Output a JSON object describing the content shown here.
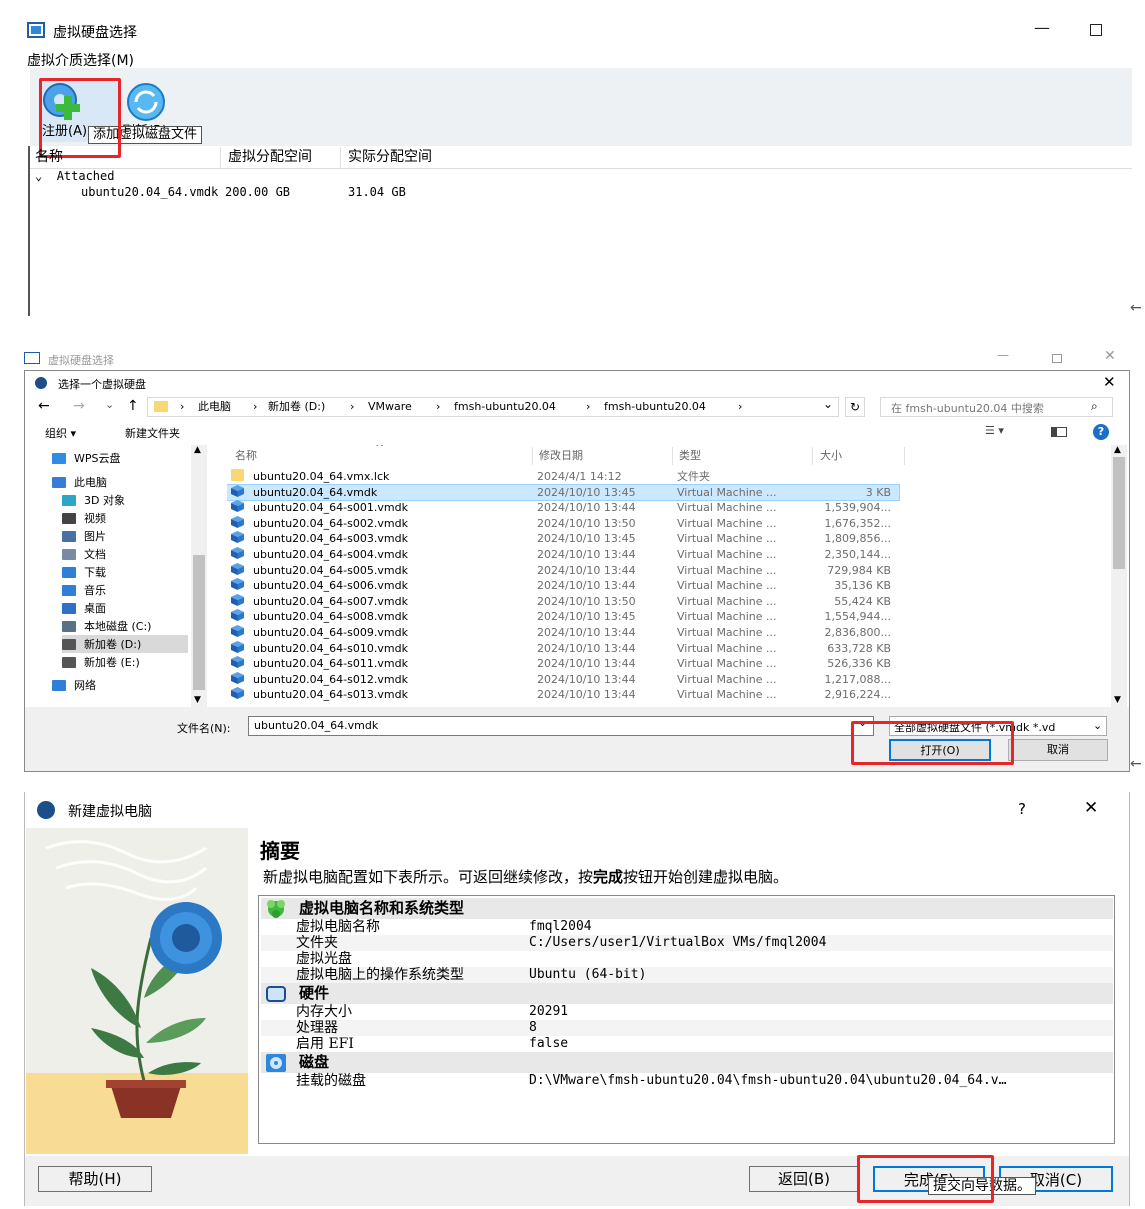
{
  "panel1": {
    "window_title": "虚拟硬盘选择",
    "menu_label": "虚拟介质选择(M)",
    "toolbar": {
      "register_label": "注册(A)",
      "refresh_label": "刷新(R)"
    },
    "tooltip": "添加虚拟磁盘文件",
    "columns": [
      "名称",
      "虚拟分配空间",
      "实际分配空间"
    ],
    "group_label": "Attached",
    "rows": [
      {
        "name": "ubuntu20.04_64.vmdk",
        "virtual": "200.00 GB",
        "actual": "31.04 GB"
      }
    ]
  },
  "panel2": {
    "bg_title": "虚拟硬盘选择",
    "dialog_title": "选择一个虚拟硬盘",
    "breadcrumb": [
      "此电脑",
      "新加卷 (D:)",
      "VMware",
      "fmsh-ubuntu20.04",
      "fmsh-ubuntu20.04"
    ],
    "search_placeholder": "在 fmsh-ubuntu20.04 中搜索",
    "toolbar": {
      "organize_label": "组织 ▾",
      "new_folder_label": "新建文件夹"
    },
    "nav": [
      {
        "label": "WPS云盘",
        "color": "#2f8de4"
      },
      {
        "label": "此电脑",
        "color": "#3a7bd5"
      },
      {
        "label": "3D 对象",
        "color": "#2aa6c9"
      },
      {
        "label": "视频",
        "color": "#444444"
      },
      {
        "label": "图片",
        "color": "#4a6fa5"
      },
      {
        "label": "文档",
        "color": "#7a8aa0"
      },
      {
        "label": "下载",
        "color": "#2f7fd8"
      },
      {
        "label": "音乐",
        "color": "#2f7fd8"
      },
      {
        "label": "桌面",
        "color": "#2f6fc8"
      },
      {
        "label": "本地磁盘 (C:)",
        "color": "#5b6f87"
      },
      {
        "label": "新加卷 (D:)",
        "color": "#555555"
      },
      {
        "label": "新加卷 (E:)",
        "color": "#555555"
      },
      {
        "label": "网络",
        "color": "#2f7fd8"
      }
    ],
    "columns": [
      "名称",
      "修改日期",
      "类型",
      "大小"
    ],
    "files": [
      {
        "name": "ubuntu20.04_64.vmx.lck",
        "date": "2024/4/1 14:12",
        "type": "文件夹",
        "size": "",
        "icon": "folder-icon"
      },
      {
        "name": "ubuntu20.04_64.vmdk",
        "date": "2024/10/10 13:45",
        "type": "Virtual Machine ...",
        "size": "3 KB",
        "icon": "vbox-disk-icon"
      },
      {
        "name": "ubuntu20.04_64-s001.vmdk",
        "date": "2024/10/10 13:44",
        "type": "Virtual Machine ...",
        "size": "1,539,904...",
        "icon": "vbox-disk-icon"
      },
      {
        "name": "ubuntu20.04_64-s002.vmdk",
        "date": "2024/10/10 13:50",
        "type": "Virtual Machine ...",
        "size": "1,676,352...",
        "icon": "vbox-disk-icon"
      },
      {
        "name": "ubuntu20.04_64-s003.vmdk",
        "date": "2024/10/10 13:45",
        "type": "Virtual Machine ...",
        "size": "1,809,856...",
        "icon": "vbox-disk-icon"
      },
      {
        "name": "ubuntu20.04_64-s004.vmdk",
        "date": "2024/10/10 13:44",
        "type": "Virtual Machine ...",
        "size": "2,350,144...",
        "icon": "vbox-disk-icon"
      },
      {
        "name": "ubuntu20.04_64-s005.vmdk",
        "date": "2024/10/10 13:44",
        "type": "Virtual Machine ...",
        "size": "729,984 KB",
        "icon": "vbox-disk-icon"
      },
      {
        "name": "ubuntu20.04_64-s006.vmdk",
        "date": "2024/10/10 13:44",
        "type": "Virtual Machine ...",
        "size": "35,136 KB",
        "icon": "vbox-disk-icon"
      },
      {
        "name": "ubuntu20.04_64-s007.vmdk",
        "date": "2024/10/10 13:50",
        "type": "Virtual Machine ...",
        "size": "55,424 KB",
        "icon": "vbox-disk-icon"
      },
      {
        "name": "ubuntu20.04_64-s008.vmdk",
        "date": "2024/10/10 13:45",
        "type": "Virtual Machine ...",
        "size": "1,554,944...",
        "icon": "vbox-disk-icon"
      },
      {
        "name": "ubuntu20.04_64-s009.vmdk",
        "date": "2024/10/10 13:44",
        "type": "Virtual Machine ...",
        "size": "2,836,800...",
        "icon": "vbox-disk-icon"
      },
      {
        "name": "ubuntu20.04_64-s010.vmdk",
        "date": "2024/10/10 13:44",
        "type": "Virtual Machine ...",
        "size": "633,728 KB",
        "icon": "vbox-disk-icon"
      },
      {
        "name": "ubuntu20.04_64-s011.vmdk",
        "date": "2024/10/10 13:44",
        "type": "Virtual Machine ...",
        "size": "526,336 KB",
        "icon": "vbox-disk-icon"
      },
      {
        "name": "ubuntu20.04_64-s012.vmdk",
        "date": "2024/10/10 13:44",
        "type": "Virtual Machine ...",
        "size": "1,217,088...",
        "icon": "vbox-disk-icon"
      },
      {
        "name": "ubuntu20.04_64-s013.vmdk",
        "date": "2024/10/10 13:44",
        "type": "Virtual Machine ...",
        "size": "2,916,224...",
        "icon": "vbox-disk-icon"
      }
    ],
    "filename_label": "文件名(N):",
    "filename_value": "ubuntu20.04_64.vmdk",
    "filter_value": "全部虚拟硬盘文件 (*.vmdk *.vd",
    "open_label": "打开(O)",
    "cancel_label": "取消"
  },
  "panel3": {
    "window_title": "新建虚拟电脑",
    "help_glyph": "?",
    "heading": "摘要",
    "description_pre": "新虚拟电脑配置如下表所示。可返回继续修改，按",
    "description_bold": "完成",
    "description_post": "按钮开始创建虚拟电脑。",
    "sections": [
      {
        "title": "虚拟电脑名称和系统类型",
        "icon": "vm-name-icon",
        "rows": [
          {
            "key": "虚拟电脑名称",
            "value": "fmql2004"
          },
          {
            "key": "文件夹",
            "value": "C:/Users/user1/VirtualBox VMs/fmql2004"
          },
          {
            "key": "虚拟光盘",
            "value": ""
          },
          {
            "key": "虚拟电脑上的操作系统类型",
            "value": "Ubuntu (64-bit)"
          }
        ]
      },
      {
        "title": "硬件",
        "icon": "hardware-icon",
        "rows": [
          {
            "key": "内存大小",
            "value": "20291"
          },
          {
            "key": "处理器",
            "value": "8"
          },
          {
            "key": "启用 EFI",
            "value": "false"
          }
        ]
      },
      {
        "title": "磁盘",
        "icon": "disk-icon",
        "rows": [
          {
            "key": "挂载的磁盘",
            "value": "D:\\VMware\\fmsh-ubuntu20.04\\fmsh-ubuntu20.04\\ubuntu20.04_64.v…"
          }
        ]
      }
    ],
    "help_label": "帮助(H)",
    "back_label": "返回(B)",
    "finish_label": "完成(F)",
    "cancel_label": "取消(C)",
    "tooltip": "提交向导数据。"
  },
  "colors": {
    "highlight_red": "#e8262a",
    "selection_blue": "#cce8ff",
    "accent_blue": "#0078d7",
    "section_gray": "#e8e8e8"
  }
}
